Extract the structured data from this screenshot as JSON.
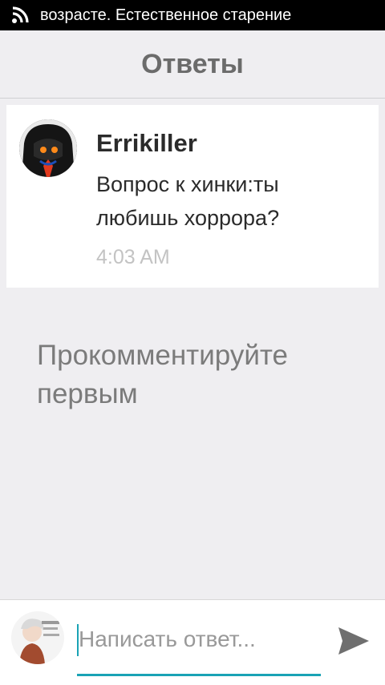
{
  "status_bar": {
    "icon": "rss-icon",
    "ticker_text": "возрасте. Естественное старение"
  },
  "header": {
    "title": "Ответы"
  },
  "reply": {
    "author": "Errikiller",
    "message": "Вопрос к хинки:ты любишь хоррора?",
    "time": "4:03 AM",
    "avatar_icon": "user-avatar-icon"
  },
  "empty_state": {
    "text": "Прокомментируйте первым"
  },
  "composer": {
    "placeholder": "Написать ответ...",
    "avatar_icon": "my-avatar-icon",
    "send_icon": "send-icon"
  },
  "colors": {
    "accent": "#1aa3b5",
    "background": "#efeef1",
    "card": "#ffffff",
    "status_bar": "#000000"
  }
}
